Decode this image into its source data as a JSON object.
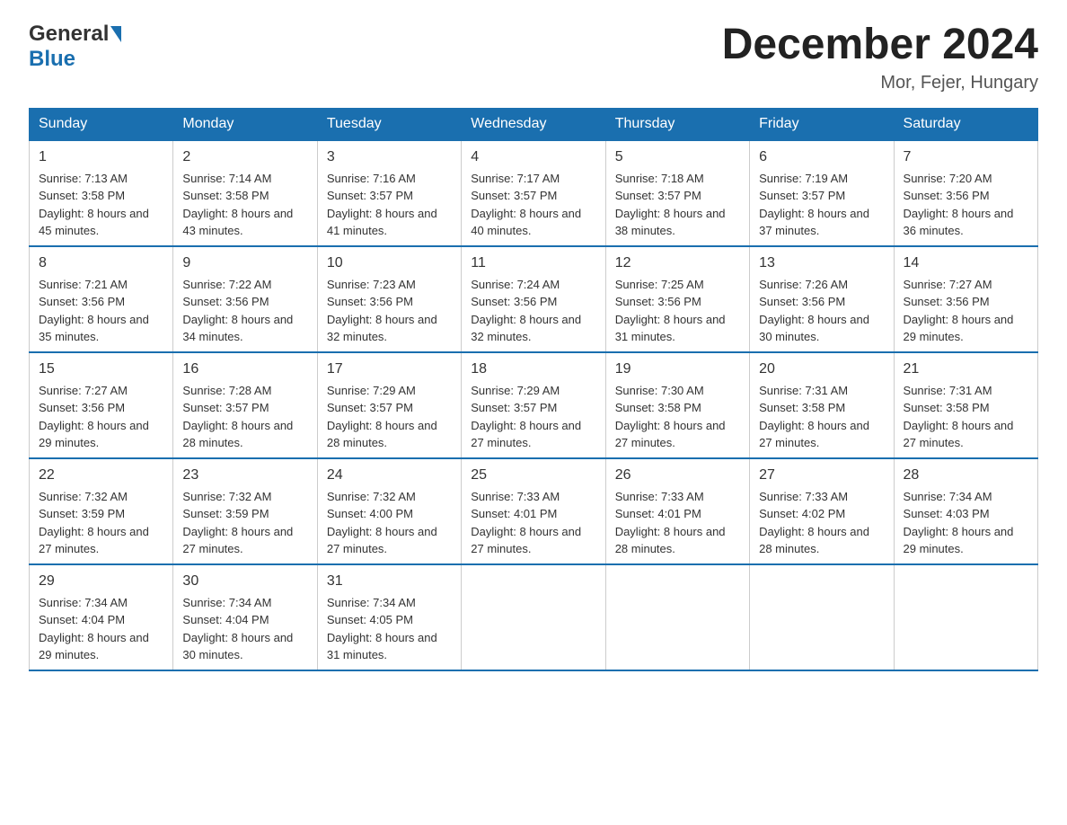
{
  "header": {
    "logo_line1": "General",
    "logo_line2": "Blue",
    "month_title": "December 2024",
    "location": "Mor, Fejer, Hungary"
  },
  "days_of_week": [
    "Sunday",
    "Monday",
    "Tuesday",
    "Wednesday",
    "Thursday",
    "Friday",
    "Saturday"
  ],
  "weeks": [
    [
      {
        "day": "1",
        "sunrise": "7:13 AM",
        "sunset": "3:58 PM",
        "daylight": "8 hours and 45 minutes."
      },
      {
        "day": "2",
        "sunrise": "7:14 AM",
        "sunset": "3:58 PM",
        "daylight": "8 hours and 43 minutes."
      },
      {
        "day": "3",
        "sunrise": "7:16 AM",
        "sunset": "3:57 PM",
        "daylight": "8 hours and 41 minutes."
      },
      {
        "day": "4",
        "sunrise": "7:17 AM",
        "sunset": "3:57 PM",
        "daylight": "8 hours and 40 minutes."
      },
      {
        "day": "5",
        "sunrise": "7:18 AM",
        "sunset": "3:57 PM",
        "daylight": "8 hours and 38 minutes."
      },
      {
        "day": "6",
        "sunrise": "7:19 AM",
        "sunset": "3:57 PM",
        "daylight": "8 hours and 37 minutes."
      },
      {
        "day": "7",
        "sunrise": "7:20 AM",
        "sunset": "3:56 PM",
        "daylight": "8 hours and 36 minutes."
      }
    ],
    [
      {
        "day": "8",
        "sunrise": "7:21 AM",
        "sunset": "3:56 PM",
        "daylight": "8 hours and 35 minutes."
      },
      {
        "day": "9",
        "sunrise": "7:22 AM",
        "sunset": "3:56 PM",
        "daylight": "8 hours and 34 minutes."
      },
      {
        "day": "10",
        "sunrise": "7:23 AM",
        "sunset": "3:56 PM",
        "daylight": "8 hours and 32 minutes."
      },
      {
        "day": "11",
        "sunrise": "7:24 AM",
        "sunset": "3:56 PM",
        "daylight": "8 hours and 32 minutes."
      },
      {
        "day": "12",
        "sunrise": "7:25 AM",
        "sunset": "3:56 PM",
        "daylight": "8 hours and 31 minutes."
      },
      {
        "day": "13",
        "sunrise": "7:26 AM",
        "sunset": "3:56 PM",
        "daylight": "8 hours and 30 minutes."
      },
      {
        "day": "14",
        "sunrise": "7:27 AM",
        "sunset": "3:56 PM",
        "daylight": "8 hours and 29 minutes."
      }
    ],
    [
      {
        "day": "15",
        "sunrise": "7:27 AM",
        "sunset": "3:56 PM",
        "daylight": "8 hours and 29 minutes."
      },
      {
        "day": "16",
        "sunrise": "7:28 AM",
        "sunset": "3:57 PM",
        "daylight": "8 hours and 28 minutes."
      },
      {
        "day": "17",
        "sunrise": "7:29 AM",
        "sunset": "3:57 PM",
        "daylight": "8 hours and 28 minutes."
      },
      {
        "day": "18",
        "sunrise": "7:29 AM",
        "sunset": "3:57 PM",
        "daylight": "8 hours and 27 minutes."
      },
      {
        "day": "19",
        "sunrise": "7:30 AM",
        "sunset": "3:58 PM",
        "daylight": "8 hours and 27 minutes."
      },
      {
        "day": "20",
        "sunrise": "7:31 AM",
        "sunset": "3:58 PM",
        "daylight": "8 hours and 27 minutes."
      },
      {
        "day": "21",
        "sunrise": "7:31 AM",
        "sunset": "3:58 PM",
        "daylight": "8 hours and 27 minutes."
      }
    ],
    [
      {
        "day": "22",
        "sunrise": "7:32 AM",
        "sunset": "3:59 PM",
        "daylight": "8 hours and 27 minutes."
      },
      {
        "day": "23",
        "sunrise": "7:32 AM",
        "sunset": "3:59 PM",
        "daylight": "8 hours and 27 minutes."
      },
      {
        "day": "24",
        "sunrise": "7:32 AM",
        "sunset": "4:00 PM",
        "daylight": "8 hours and 27 minutes."
      },
      {
        "day": "25",
        "sunrise": "7:33 AM",
        "sunset": "4:01 PM",
        "daylight": "8 hours and 27 minutes."
      },
      {
        "day": "26",
        "sunrise": "7:33 AM",
        "sunset": "4:01 PM",
        "daylight": "8 hours and 28 minutes."
      },
      {
        "day": "27",
        "sunrise": "7:33 AM",
        "sunset": "4:02 PM",
        "daylight": "8 hours and 28 minutes."
      },
      {
        "day": "28",
        "sunrise": "7:34 AM",
        "sunset": "4:03 PM",
        "daylight": "8 hours and 29 minutes."
      }
    ],
    [
      {
        "day": "29",
        "sunrise": "7:34 AM",
        "sunset": "4:04 PM",
        "daylight": "8 hours and 29 minutes."
      },
      {
        "day": "30",
        "sunrise": "7:34 AM",
        "sunset": "4:04 PM",
        "daylight": "8 hours and 30 minutes."
      },
      {
        "day": "31",
        "sunrise": "7:34 AM",
        "sunset": "4:05 PM",
        "daylight": "8 hours and 31 minutes."
      },
      null,
      null,
      null,
      null
    ]
  ],
  "labels": {
    "sunrise_prefix": "Sunrise: ",
    "sunset_prefix": "Sunset: ",
    "daylight_prefix": "Daylight: "
  }
}
